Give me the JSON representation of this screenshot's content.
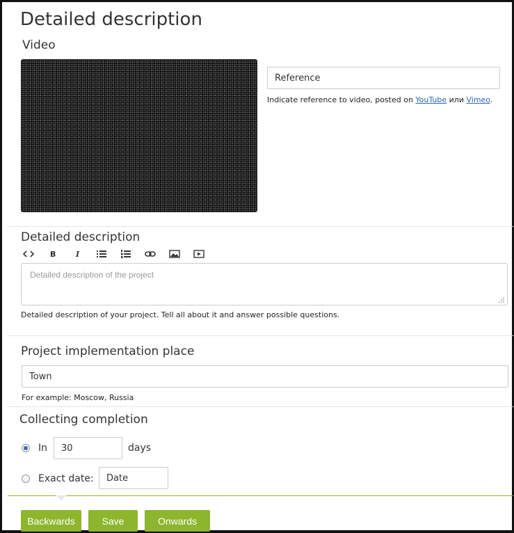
{
  "page": {
    "title": "Detailed description"
  },
  "video": {
    "section_title": "Video",
    "reference_value": "Reference",
    "hint_prefix": "Indicate reference to video, posted on ",
    "link_youtube": "YouTube",
    "hint_or": " или ",
    "link_vimeo": "Vimeo",
    "hint_suffix": "."
  },
  "description": {
    "section_title": "Detailed description",
    "toolbar": [
      "code-icon",
      "bold-icon",
      "italic-icon",
      "bullet-list-icon",
      "numbered-list-icon",
      "link-icon",
      "image-icon",
      "video-icon"
    ],
    "toolbar_bold": "B",
    "toolbar_italic": "I",
    "placeholder": "Detailed description of the project",
    "hint": "Detailed description of your project. Tell all about it and answer possible questions."
  },
  "place": {
    "section_title": "Project implementation place",
    "value": "Town",
    "hint": "For example: Moscow, Russia"
  },
  "completion": {
    "section_title": "Collecting completion",
    "option_days_label": "In",
    "days_value": "30",
    "days_unit": "days",
    "option_date_label": "Exact date:",
    "date_value": "Date",
    "selected": "days"
  },
  "buttons": {
    "back": "Backwards",
    "save": "Save",
    "next": "Onwards"
  },
  "colors": {
    "accent_green": "#8db52e",
    "link_blue": "#2a6ab0",
    "radio_blue": "#2f6fb5"
  }
}
